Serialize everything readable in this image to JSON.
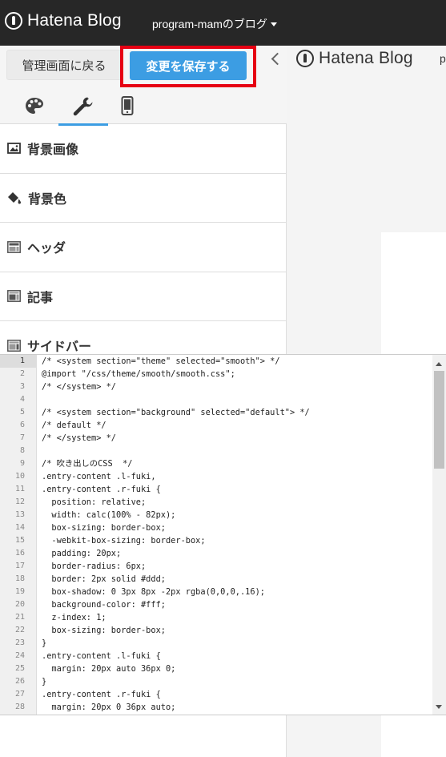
{
  "app": {
    "logo_text": "Hatena Blog",
    "blog_name": "program-mamのブログ"
  },
  "toolbar": {
    "back_label": "管理画面に戻る",
    "save_label": "変更を保存する"
  },
  "tabs": [
    {
      "name": "design",
      "icon": "palette-icon"
    },
    {
      "name": "customize",
      "icon": "wrench-icon",
      "active": true
    },
    {
      "name": "smartphone",
      "icon": "smartphone-icon"
    }
  ],
  "sections": [
    {
      "label": "背景画像",
      "icon": "image-icon"
    },
    {
      "label": "背景色",
      "icon": "paint-bucket-icon"
    },
    {
      "label": "ヘッダ",
      "icon": "header-layout-icon"
    },
    {
      "label": "記事",
      "icon": "article-layout-icon"
    },
    {
      "label": "サイドバー",
      "icon": "sidebar-layout-icon"
    }
  ],
  "preview": {
    "logo_text": "Hatena Blog",
    "extra_text": "p"
  },
  "editor": {
    "lines": [
      "/* <system section=\"theme\" selected=\"smooth\"> */",
      "@import \"/css/theme/smooth/smooth.css\";",
      "/* </system> */",
      "",
      "/* <system section=\"background\" selected=\"default\"> */",
      "/* default */",
      "/* </system> */",
      "",
      "/* 吹き出しのCSS  */",
      ".entry-content .l-fuki,",
      ".entry-content .r-fuki {",
      "  position: relative;",
      "  width: calc(100% - 82px);",
      "  box-sizing: border-box;",
      "  -webkit-box-sizing: border-box;",
      "  padding: 20px;",
      "  border-radius: 6px;",
      "  border: 2px solid #ddd;",
      "  box-shadow: 0 3px 8px -2px rgba(0,0,0,.16);",
      "  background-color: #fff;",
      "  z-index: 1;",
      "  box-sizing: border-box;",
      "}",
      ".entry-content .l-fuki {",
      "  margin: 20px auto 36px 0;",
      "}",
      ".entry-content .r-fuki {",
      "  margin: 20px 0 36px auto;"
    ],
    "line_numbers": [
      "1",
      "2",
      "3",
      "4",
      "5",
      "6",
      "7",
      "8",
      "9",
      "10",
      "11",
      "12",
      "13",
      "14",
      "15",
      "16",
      "17",
      "18",
      "19",
      "20",
      "21",
      "22",
      "23",
      "24",
      "25",
      "26",
      "27",
      "28"
    ],
    "active_line": 1
  },
  "colors": {
    "topbar": "#272727",
    "save_button": "#3c9de3",
    "highlight_frame": "#e60012"
  }
}
